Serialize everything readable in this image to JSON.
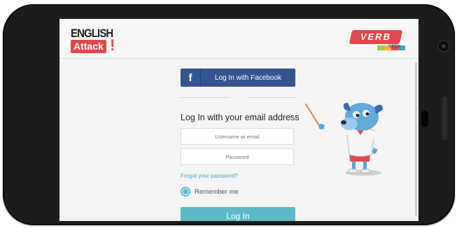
{
  "header": {
    "brand_logo_line1": "ENGLISH",
    "brand_logo_line2": "Attack",
    "brand_logo_mark": "!",
    "partner_logo_text": "VERB",
    "partner_logo_sub": "OPEN"
  },
  "login": {
    "facebook_icon": "f",
    "facebook_label": "Log In with Facebook",
    "title": "Log In with your email address",
    "username_placeholder": "Username or email",
    "password_placeholder": "Password",
    "forgot_link": "Forgot your password?",
    "remember_label": "Remember me",
    "remember_checked": true,
    "login_button": "Log In"
  },
  "colors": {
    "brand_red": "#e2474b",
    "facebook_blue": "#34558f",
    "accent_teal": "#5db8c8",
    "link_blue": "#3fa3c3"
  },
  "icons": [
    "facebook-icon",
    "radio-checked-icon",
    "mascot-illustration"
  ]
}
